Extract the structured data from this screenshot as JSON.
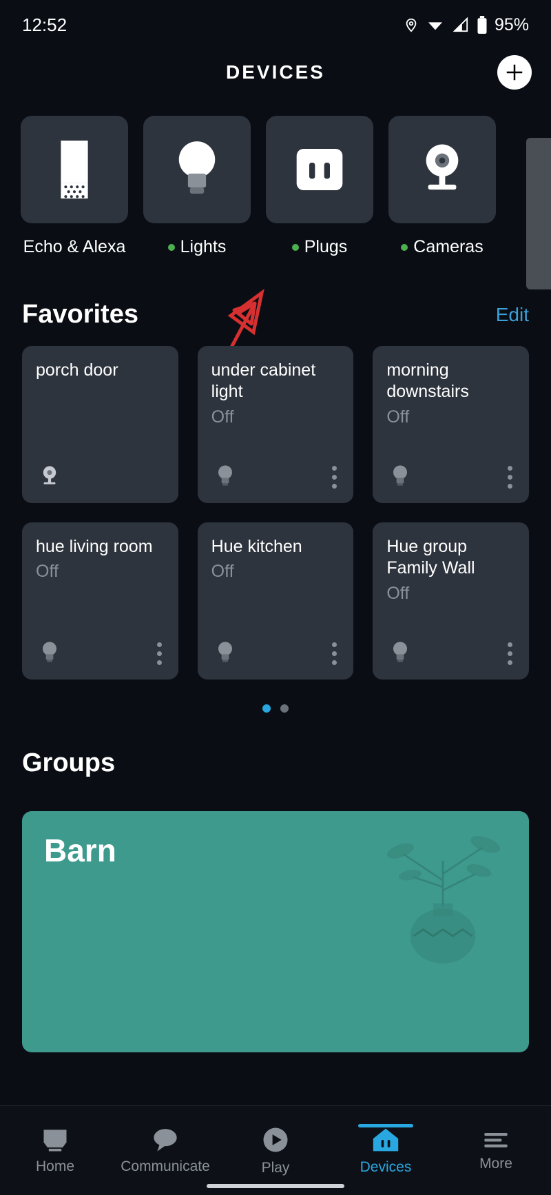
{
  "status": {
    "time": "12:52",
    "battery": "95%"
  },
  "header": {
    "title": "DEVICES"
  },
  "categories": [
    {
      "label": "Echo & Alexa",
      "icon": "echo",
      "dot": false
    },
    {
      "label": "Lights",
      "icon": "bulb",
      "dot": true
    },
    {
      "label": "Plugs",
      "icon": "plug",
      "dot": true
    },
    {
      "label": "Cameras",
      "icon": "camera",
      "dot": true
    }
  ],
  "favorites": {
    "title": "Favorites",
    "edit": "Edit",
    "cards": [
      {
        "name": "porch door",
        "state": "",
        "icon": "camera-small"
      },
      {
        "name": "under cabinet light",
        "state": "Off",
        "icon": "bulb-small"
      },
      {
        "name": "morning downstairs",
        "state": "Off",
        "icon": "bulb-small"
      },
      {
        "name": "hue living room",
        "state": "Off",
        "icon": "bulb-small"
      },
      {
        "name": "Hue kitchen",
        "state": "Off",
        "icon": "bulb-small"
      },
      {
        "name": "Hue group Family Wall",
        "state": "Off",
        "icon": "bulb-small"
      }
    ],
    "page_active": 0,
    "page_count": 2
  },
  "groups": {
    "title": "Groups",
    "cards": [
      {
        "name": "Barn",
        "color": "#3f9a8e"
      }
    ]
  },
  "nav": {
    "items": [
      {
        "label": "Home"
      },
      {
        "label": "Communicate"
      },
      {
        "label": "Play"
      },
      {
        "label": "Devices"
      },
      {
        "label": "More"
      }
    ],
    "active_index": 3
  }
}
